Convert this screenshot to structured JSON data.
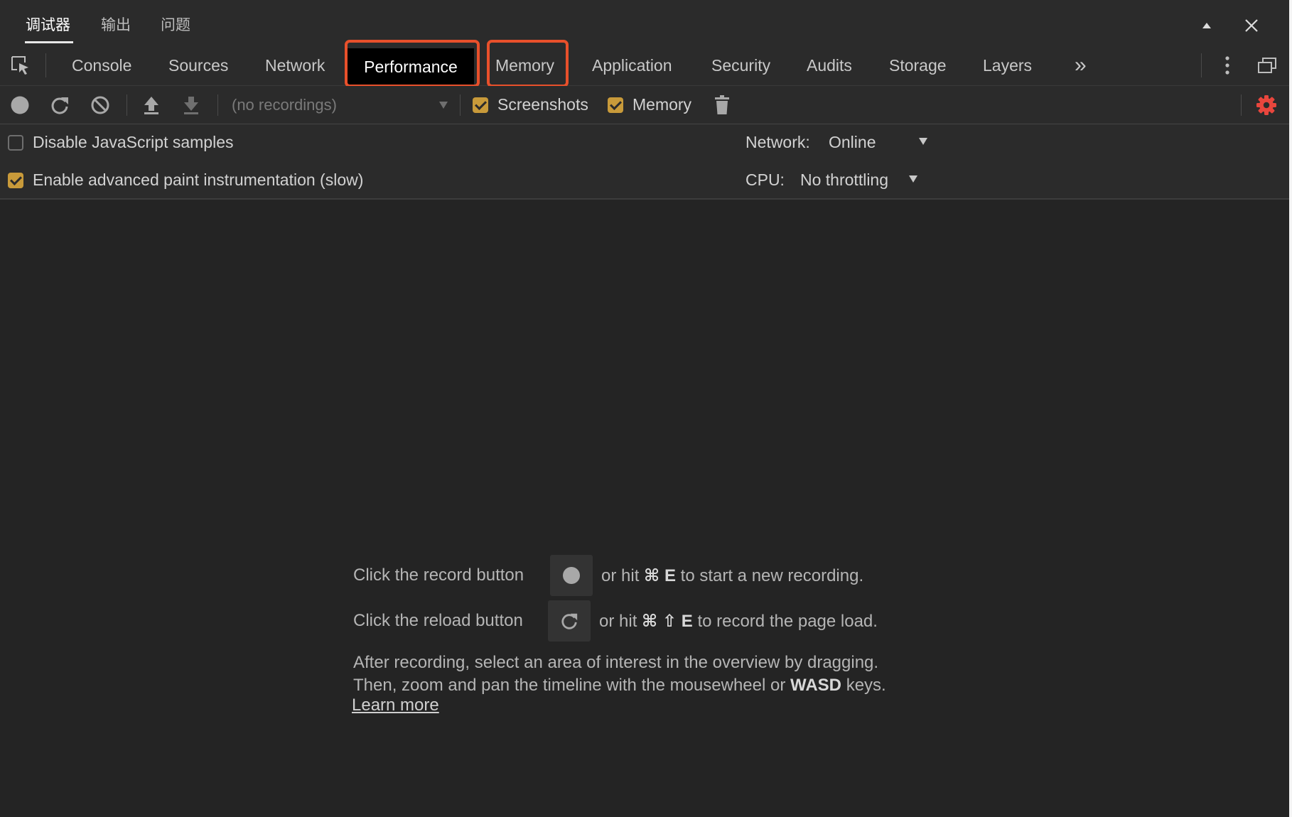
{
  "drawer": {
    "tabs": [
      {
        "label": "调试器",
        "active": true
      },
      {
        "label": "输出",
        "active": false
      },
      {
        "label": "问题",
        "active": false
      }
    ]
  },
  "tabs": {
    "console": "Console",
    "sources": "Sources",
    "network": "Network",
    "performance": "Performance",
    "memory": "Memory",
    "application": "Application",
    "security": "Security",
    "audits": "Audits",
    "storage": "Storage",
    "layers": "Layers",
    "more": "»"
  },
  "toolbar": {
    "recordings_placeholder": "(no recordings)",
    "screenshots_label": "Screenshots",
    "screenshots_checked": true,
    "memory_label": "Memory",
    "memory_checked": true
  },
  "settings": {
    "disable_js_samples": "Disable JavaScript samples",
    "disable_js_checked": false,
    "advanced_paint": "Enable advanced paint instrumentation (slow)",
    "advanced_paint_checked": true,
    "network_label": "Network:",
    "network_value": "Online",
    "cpu_label": "CPU:",
    "cpu_value": "No throttling"
  },
  "landing": {
    "record_prefix": "Click the record button",
    "record_middle": "or hit",
    "record_key_cmd": "⌘",
    "record_key": "E",
    "record_suffix": "to start a new recording.",
    "reload_prefix": "Click the reload button",
    "reload_middle": "or hit",
    "reload_key_cmd": "⌘",
    "reload_key_shift": "⇧",
    "reload_key": "E",
    "reload_suffix": "to record the page load.",
    "after_line1": "After recording, select an area of interest in the overview by dragging.",
    "after_line2_prefix": "Then, zoom and pan the timeline with the mousewheel or",
    "after_line2_key": "WASD",
    "after_line2_suffix": "keys.",
    "learn_more": "Learn more"
  },
  "colors": {
    "highlight": "#e8502b",
    "checkbox": "#c89a3a",
    "settings_gear": "#e8463d",
    "background": "#242424",
    "toolbar": "#2b2b2b"
  }
}
